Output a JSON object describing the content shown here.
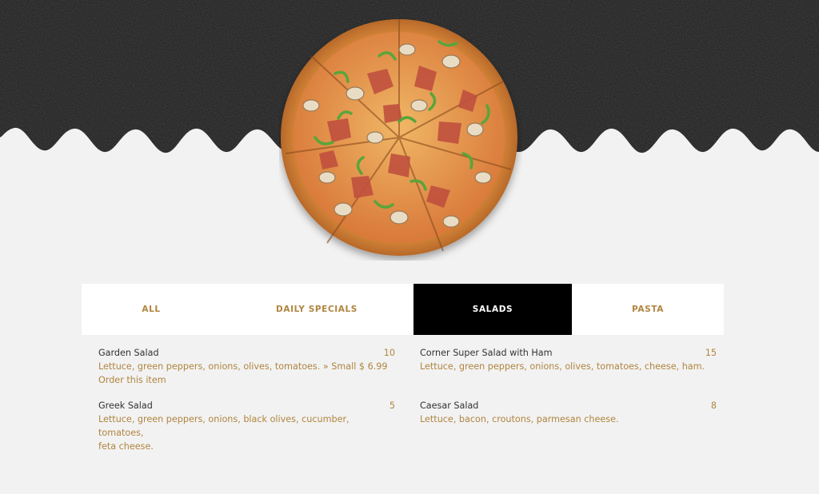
{
  "colors": {
    "accent": "#b0853f",
    "dark": "#000000",
    "background": "#f2f2f2",
    "hero": "#141414"
  },
  "hero": {
    "image": "pizza-image"
  },
  "tabs": [
    {
      "label": "ALL",
      "active": false
    },
    {
      "label": "DAILY SPECIALS",
      "active": false
    },
    {
      "label": "SALADS",
      "active": true
    },
    {
      "label": "PASTA",
      "active": false
    }
  ],
  "menu": {
    "items": [
      {
        "name": "Garden Salad",
        "price": "10",
        "description": "Lettuce, green peppers, onions, olives, tomatoes. » Small $ 6.99",
        "order_label": "Order this item"
      },
      {
        "name": "Corner Super Salad with Ham",
        "price": "15",
        "description": "Lettuce, green peppers, onions, olives, tomatoes, cheese, ham."
      },
      {
        "name": "Greek Salad",
        "price": "5",
        "description_line1": "Lettuce, green peppers, onions, black olives, cucumber, tomatoes,",
        "description_line2": "feta cheese."
      },
      {
        "name": "Caesar Salad",
        "price": "8",
        "description": "Lettuce, bacon, croutons, parmesan cheese."
      }
    ]
  }
}
